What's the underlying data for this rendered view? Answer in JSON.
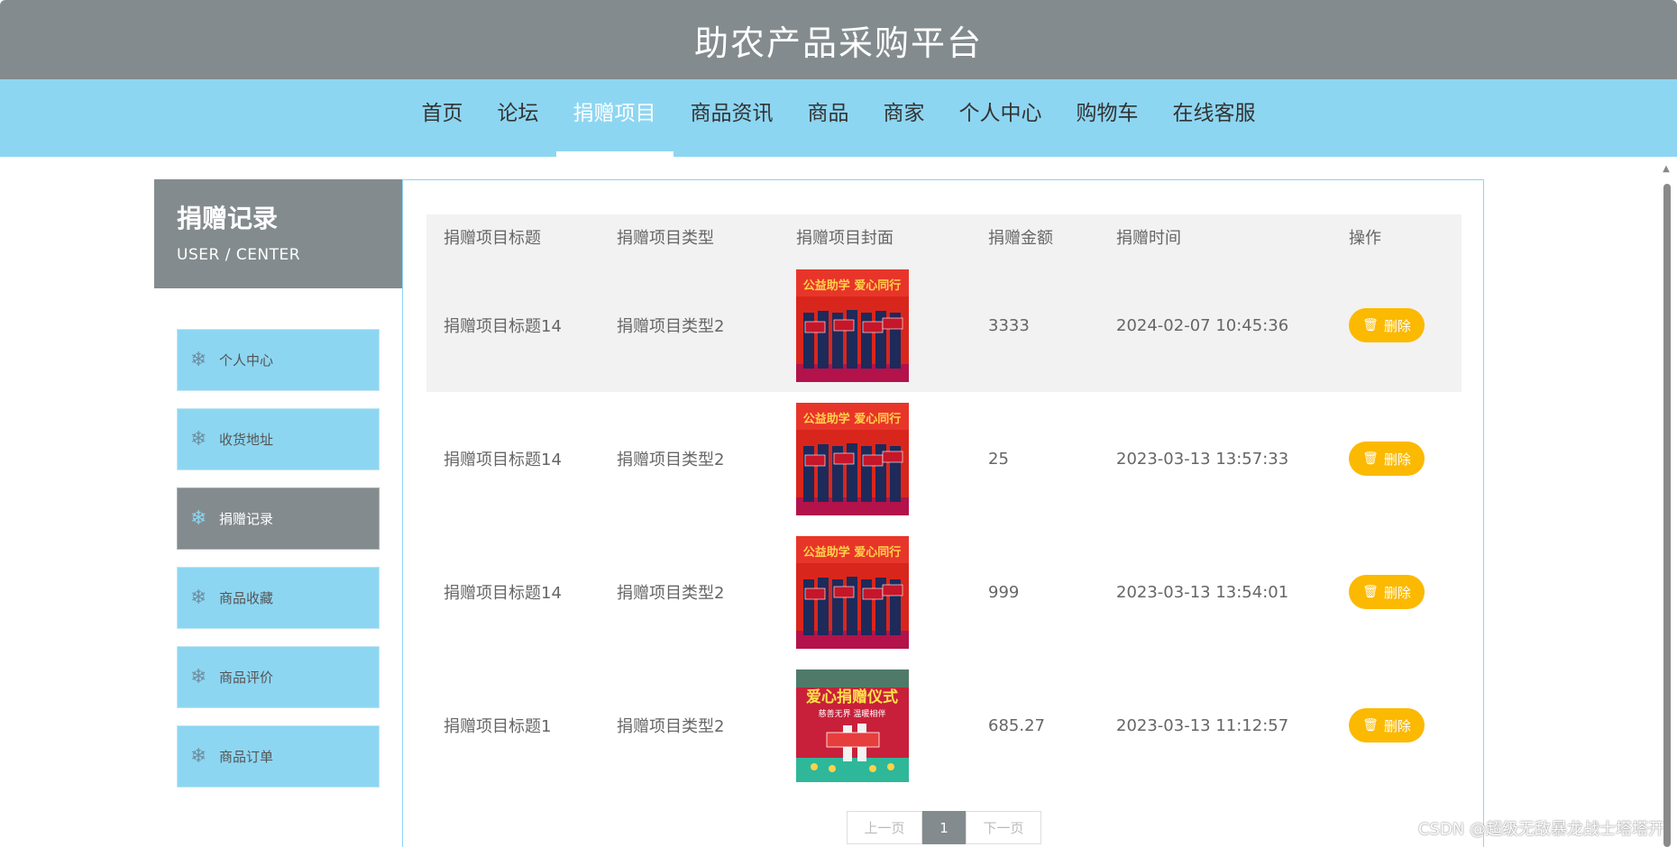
{
  "header": {
    "title": "助农产品采购平台"
  },
  "nav": {
    "items": [
      "首页",
      "论坛",
      "捐赠项目",
      "商品资讯",
      "商品",
      "商家",
      "个人中心",
      "购物车",
      "在线客服"
    ],
    "active_index": 2
  },
  "sidebar": {
    "title": "捐赠记录",
    "subtitle": "USER / CENTER",
    "items": [
      "个人中心",
      "收货地址",
      "捐赠记录",
      "商品收藏",
      "商品评价",
      "商品订单"
    ],
    "active_index": 2,
    "item_icon": "snowflake-icon"
  },
  "table": {
    "headers": [
      "捐赠项目标题",
      "捐赠项目类型",
      "捐赠项目封面",
      "捐赠金额",
      "捐赠时间",
      "操作"
    ],
    "rows": [
      {
        "title": "捐赠项目标题14",
        "type": "捐赠项目类型2",
        "amount": "3333",
        "time": "2024-02-07 10:45:36",
        "cover": "donation-ceremony-red"
      },
      {
        "title": "捐赠项目标题14",
        "type": "捐赠项目类型2",
        "amount": "25",
        "time": "2023-03-13 13:57:33",
        "cover": "donation-ceremony-red"
      },
      {
        "title": "捐赠项目标题14",
        "type": "捐赠项目类型2",
        "amount": "999",
        "time": "2023-03-13 13:54:01",
        "cover": "donation-ceremony-red"
      },
      {
        "title": "捐赠项目标题1",
        "type": "捐赠项目类型2",
        "amount": "685.27",
        "time": "2023-03-13 11:12:57",
        "cover": "donation-ceremony-banner"
      }
    ],
    "delete_label": "删除"
  },
  "cover_text": {
    "red_banner": "公益助学 爱心同行",
    "green_banner": "爱心捐赠仪式",
    "green_sub": "慈善无界 温暖相伴"
  },
  "pagination": {
    "prev": "上一页",
    "current": "1",
    "next": "下一页"
  },
  "watermark": "CSDN @超级无敌暴龙战士塔塔开",
  "colors": {
    "title_bar": "#838b8e",
    "nav_bar": "#8dd6f2",
    "delete_button": "#fbb901",
    "active_item": "#838b8e"
  }
}
